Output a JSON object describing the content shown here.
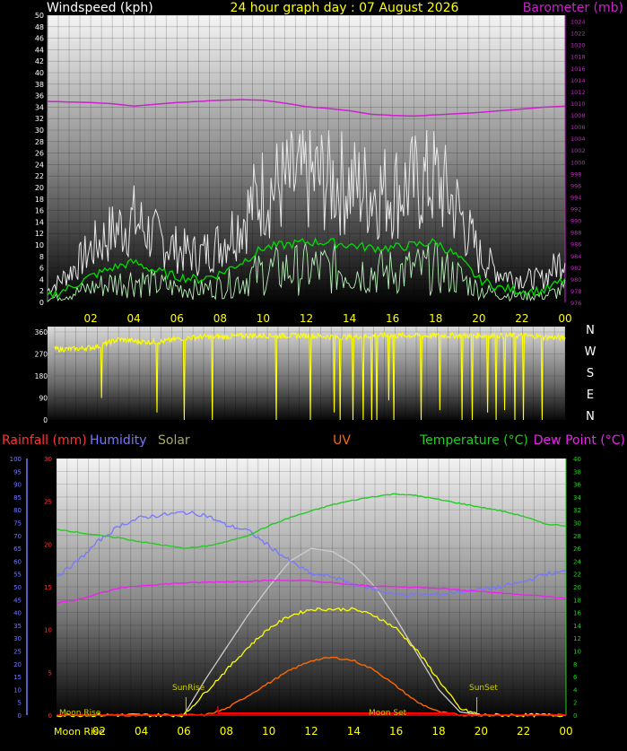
{
  "header": {
    "left_label": "Windspeed (kph)",
    "title": "24 hour graph day : 07 August 2026",
    "right_label": "Barometer (mb)"
  },
  "colors": {
    "windspeed": "#e8e8e8",
    "windavg": "#00dd00",
    "windlow": "#b8f0b8",
    "barometer": "#cc22cc",
    "winddir": "#ffff00",
    "rainfall": "#ff3333",
    "humidity": "#7777ff",
    "solar": "#aaaa66",
    "uv": "#ff6600",
    "temperature": "#22cc22",
    "dewpoint": "#ee22ee",
    "solar_line": "#ffff00",
    "solar_max": "#cccccc",
    "uv_line": "#ff6600",
    "rain_line": "#ff0000",
    "sun_label": "#cccc00",
    "moon_label": "#ffff00"
  },
  "time_ticks": [
    "02",
    "04",
    "06",
    "08",
    "10",
    "12",
    "14",
    "16",
    "18",
    "20",
    "22",
    "00"
  ],
  "wind_chart": {
    "left_ticks": [
      "0",
      "2",
      "4",
      "6",
      "8",
      "10",
      "12",
      "14",
      "16",
      "18",
      "20",
      "22",
      "24",
      "26",
      "28",
      "30",
      "32",
      "34",
      "36",
      "38",
      "40",
      "42",
      "44",
      "46",
      "48",
      "50"
    ],
    "right_ticks": [
      "976",
      "978",
      "980",
      "982",
      "984",
      "986",
      "988",
      "990",
      "992",
      "994",
      "996",
      "998",
      "1000",
      "1002",
      "1004",
      "1006",
      "1008",
      "1010",
      "1012",
      "1014",
      "1016",
      "1018",
      "1020",
      "1022",
      "1024"
    ]
  },
  "dir_chart": {
    "left_ticks": [
      "0",
      "90",
      "180",
      "270",
      "360"
    ],
    "compass": [
      "N",
      "W",
      "S",
      "E",
      "N"
    ]
  },
  "bottom_chart": {
    "labels": {
      "rainfall": "Rainfall (mm)",
      "humidity": "Humidity",
      "solar": "Solar",
      "uv": "UV",
      "temperature": "Temperature (°C)",
      "dewpoint": "Dew Point (°C)"
    },
    "hum_ticks": [
      "0",
      "5",
      "10",
      "15",
      "20",
      "25",
      "30",
      "35",
      "40",
      "45",
      "50",
      "55",
      "60",
      "65",
      "70",
      "75",
      "80",
      "85",
      "90",
      "95",
      "100"
    ],
    "rain_ticks": [
      "0",
      "5",
      "10",
      "15",
      "20",
      "25",
      "30"
    ],
    "temp_ticks": [
      "0",
      "2",
      "4",
      "6",
      "8",
      "10",
      "12",
      "14",
      "16",
      "18",
      "20",
      "22",
      "24",
      "26",
      "28",
      "30",
      "32",
      "34",
      "36",
      "38",
      "40"
    ],
    "annotations": {
      "sunrise": "SunRise",
      "sunset": "SunSet",
      "moonrise": "Moon Rise",
      "moonset": "Moon Set"
    }
  },
  "chart_data": [
    {
      "type": "line",
      "title": "24 hour graph day : 07 August 2026",
      "xlabel": "",
      "ylabel": "Windspeed (kph)",
      "y2label": "Barometer (mb)",
      "ylim": [
        0,
        50
      ],
      "y2lim": [
        976,
        1025
      ],
      "hours": [
        0,
        1,
        2,
        3,
        4,
        5,
        6,
        7,
        8,
        9,
        10,
        11,
        12,
        13,
        14,
        15,
        16,
        17,
        18,
        19,
        20,
        21,
        22,
        23,
        24
      ],
      "series": [
        {
          "name": "Windspeed (kph)",
          "values": [
            2,
            5,
            9,
            12,
            14,
            11,
            9,
            8,
            10,
            14,
            19,
            20,
            21,
            21,
            20,
            19,
            19,
            20,
            21,
            16,
            8,
            5,
            4,
            4,
            8
          ]
        },
        {
          "name": "Barometer (mb)",
          "values": [
            1010.3,
            1010.2,
            1010.1,
            1009.9,
            1009.5,
            1009.8,
            1010.1,
            1010.3,
            1010.5,
            1010.6,
            1010.5,
            1010.0,
            1009.4,
            1009.1,
            1008.7,
            1008.1,
            1007.9,
            1007.8,
            1008.0,
            1008.2,
            1008.4,
            1008.7,
            1009.0,
            1009.3,
            1009.5
          ]
        }
      ]
    },
    {
      "type": "line",
      "title": "",
      "ylabel": "",
      "ylim": [
        0,
        360
      ],
      "hours": [
        0,
        1,
        2,
        3,
        4,
        5,
        6,
        7,
        8,
        9,
        10,
        11,
        12,
        13,
        14,
        15,
        16,
        17,
        18,
        19,
        20,
        21,
        22,
        23,
        24
      ],
      "series": [
        {
          "name": "Wind direction",
          "values": [
            290,
            290,
            300,
            330,
            320,
            320,
            335,
            340,
            340,
            345,
            345,
            345,
            345,
            340,
            340,
            345,
            345,
            345,
            345,
            345,
            345,
            345,
            345,
            340,
            335
          ]
        }
      ]
    },
    {
      "type": "line",
      "title": "",
      "ylim": [
        0,
        40
      ],
      "hours": [
        0,
        1,
        2,
        3,
        4,
        5,
        6,
        7,
        8,
        9,
        10,
        11,
        12,
        13,
        14,
        15,
        16,
        17,
        18,
        19,
        20,
        21,
        22,
        23,
        24
      ],
      "series": [
        {
          "name": "Humidity",
          "values": [
            54,
            60,
            68,
            74,
            77,
            78,
            79,
            78,
            74,
            72,
            66,
            60,
            55,
            54,
            51,
            49,
            47,
            47,
            47,
            48,
            49,
            50,
            52,
            55,
            56
          ]
        },
        {
          "name": "Temperature (°C)",
          "values": [
            29.0,
            28.5,
            28.0,
            27.6,
            27.0,
            26.5,
            26.0,
            26.3,
            27.0,
            28.0,
            29.5,
            30.8,
            31.8,
            32.8,
            33.5,
            34.1,
            34.5,
            34.2,
            33.6,
            33.0,
            32.4,
            31.8,
            31.0,
            29.8,
            29.5
          ]
        },
        {
          "name": "Dew Point (°C)",
          "values": [
            17.5,
            18.0,
            19.0,
            19.8,
            20.2,
            20.4,
            20.6,
            20.7,
            20.8,
            20.9,
            21.0,
            21.0,
            20.9,
            20.6,
            20.3,
            20.1,
            20.0,
            19.9,
            19.8,
            19.5,
            19.3,
            19.0,
            18.8,
            18.5,
            18.2
          ]
        },
        {
          "name": "Solar",
          "values": [
            0,
            0,
            0,
            0,
            0,
            0,
            0,
            3.5,
            7.0,
            10.5,
            13.5,
            15.5,
            16.5,
            16.5,
            16.5,
            15.5,
            13.5,
            10,
            5.5,
            1.0,
            0,
            0,
            0,
            0,
            0
          ]
        },
        {
          "name": "Solar max",
          "values": [
            0,
            0,
            0,
            0,
            0,
            0,
            0,
            5.5,
            10.5,
            15.5,
            20.0,
            24.0,
            26.0,
            25.5,
            23.5,
            20.0,
            15.0,
            9.5,
            4.0,
            0.5,
            0,
            0,
            0,
            0,
            0
          ]
        },
        {
          "name": "UV",
          "values": [
            0,
            0,
            0,
            0,
            0,
            0,
            0,
            0,
            1.0,
            3.0,
            5.0,
            7.0,
            8.5,
            9.0,
            8.5,
            7.0,
            4.5,
            2.0,
            0.5,
            0,
            0,
            0,
            0,
            0,
            0
          ]
        },
        {
          "name": "Rainfall (mm)",
          "values": [
            0,
            0,
            0,
            0,
            0,
            0,
            0,
            0,
            0,
            0,
            0,
            0,
            0,
            0,
            0,
            0,
            0,
            0,
            0,
            0,
            0,
            0,
            0,
            0,
            0
          ]
        }
      ]
    }
  ]
}
